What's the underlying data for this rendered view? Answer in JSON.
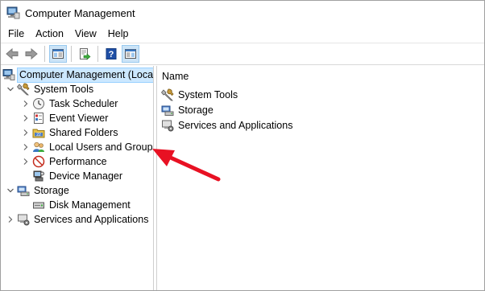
{
  "window": {
    "title": "Computer Management"
  },
  "menu": [
    "File",
    "Action",
    "View",
    "Help"
  ],
  "toolbar": {
    "buttons": [
      {
        "name": "back-button",
        "icon": "arrow-left-icon"
      },
      {
        "name": "forward-button",
        "icon": "arrow-right-icon"
      },
      {
        "name": "show-hide-console-tree-button",
        "icon": "console-tree-icon"
      },
      {
        "name": "export-list-button",
        "icon": "export-icon"
      },
      {
        "name": "help-button",
        "icon": "help-icon"
      },
      {
        "name": "show-hide-action-pane-button",
        "icon": "action-pane-icon"
      }
    ]
  },
  "tree": {
    "root": "Computer Management (Local",
    "system_tools": "System Tools",
    "task_scheduler": "Task Scheduler",
    "event_viewer": "Event Viewer",
    "shared_folders": "Shared Folders",
    "local_users": "Local Users and Groups",
    "performance": "Performance",
    "device_manager": "Device Manager",
    "storage": "Storage",
    "disk_management": "Disk Management",
    "services": "Services and Applications"
  },
  "list": {
    "column_name": "Name",
    "items": [
      "System Tools",
      "Storage",
      "Services and Applications"
    ]
  },
  "colors": {
    "selection": "#cce8ff",
    "annotation_arrow": "#e81123"
  }
}
